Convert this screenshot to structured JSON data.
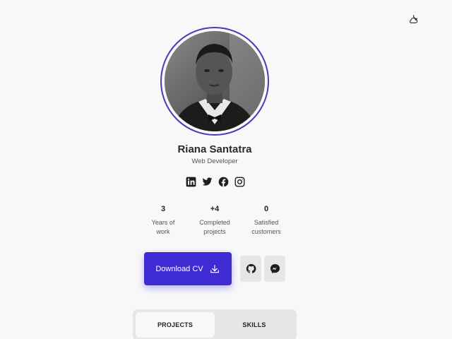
{
  "theme_toggle": {
    "icon": "moon-cloud-icon"
  },
  "profile": {
    "name": "Riana Santatra",
    "role": "Web Developer",
    "accent_color": "#3f2bd3"
  },
  "socials": [
    {
      "icon": "linkedin-icon"
    },
    {
      "icon": "twitter-icon"
    },
    {
      "icon": "facebook-icon"
    },
    {
      "icon": "instagram-icon"
    }
  ],
  "stats": [
    {
      "value": "3",
      "label_1": "Years of",
      "label_2": "work"
    },
    {
      "value": "+4",
      "label_1": "Completed",
      "label_2": "projects"
    },
    {
      "value": "0",
      "label_1": "Satisfied",
      "label_2": "customers"
    }
  ],
  "actions": {
    "download_label": "Download CV",
    "download_icon": "download-icon",
    "github_icon": "github-icon",
    "messenger_icon": "messenger-icon"
  },
  "tabs": [
    {
      "label": "PROJECTS",
      "active": true
    },
    {
      "label": "SKILLS",
      "active": false
    }
  ]
}
